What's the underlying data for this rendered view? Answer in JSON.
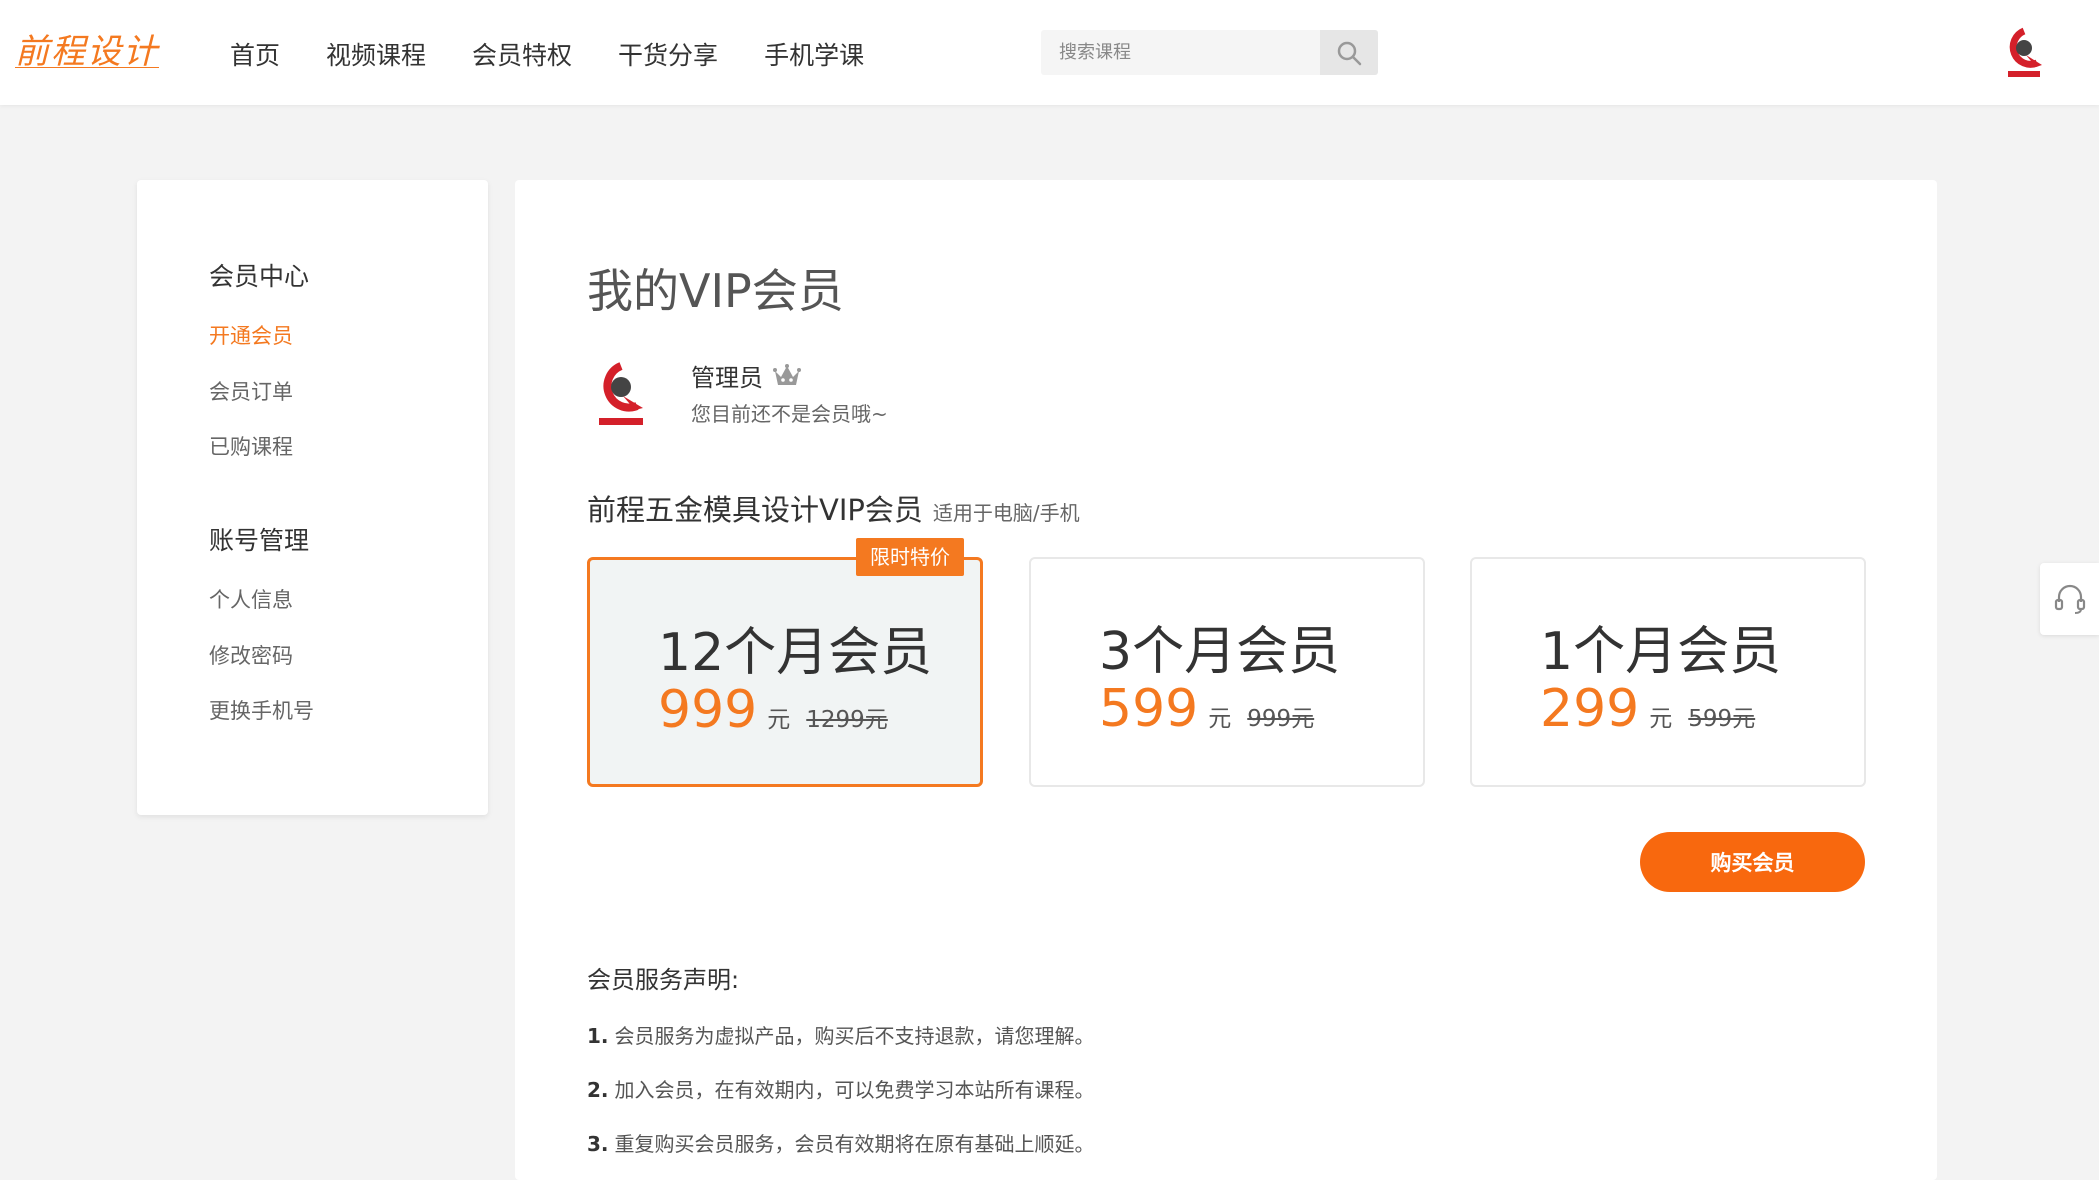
{
  "header": {
    "logo": "前程设计",
    "nav": [
      "首页",
      "视频课程",
      "会员特权",
      "干货分享",
      "手机学课"
    ],
    "search_placeholder": "搜索课程",
    "brand_color": "#f47920"
  },
  "sidebar": {
    "groups": [
      {
        "title": "会员中心",
        "items": [
          "开通会员",
          "会员订单",
          "已购课程"
        ]
      },
      {
        "title": "账号管理",
        "items": [
          "个人信息",
          "修改密码",
          "更换手机号"
        ]
      }
    ],
    "active_item": "开通会员"
  },
  "main": {
    "title": "我的VIP会员",
    "user": {
      "name": "管理员",
      "status": "您目前还不是会员哦~"
    },
    "vip_title": "前程五金模具设计VIP会员",
    "vip_subtitle": "适用于电脑/手机",
    "plans": [
      {
        "name": "12个月会员",
        "price": "999",
        "unit": "元",
        "original": "1299元",
        "badge": "限时特价",
        "selected": true
      },
      {
        "name": "3个月会员",
        "price": "599",
        "unit": "元",
        "original": "999元",
        "selected": false
      },
      {
        "name": "1个月会员",
        "price": "299",
        "unit": "元",
        "original": "599元",
        "selected": false
      }
    ],
    "buy_label": "购买会员",
    "notice_title": "会员服务声明:",
    "notices": [
      {
        "num": "1.",
        "text": "会员服务为虚拟产品，购买后不支持退款，请您理解。"
      },
      {
        "num": "2.",
        "text": "加入会员，在有效期内，可以免费学习本站所有课程。"
      },
      {
        "num": "3.",
        "text": "重复购买会员服务，会员有效期将在原有基础上顺延。"
      }
    ]
  }
}
